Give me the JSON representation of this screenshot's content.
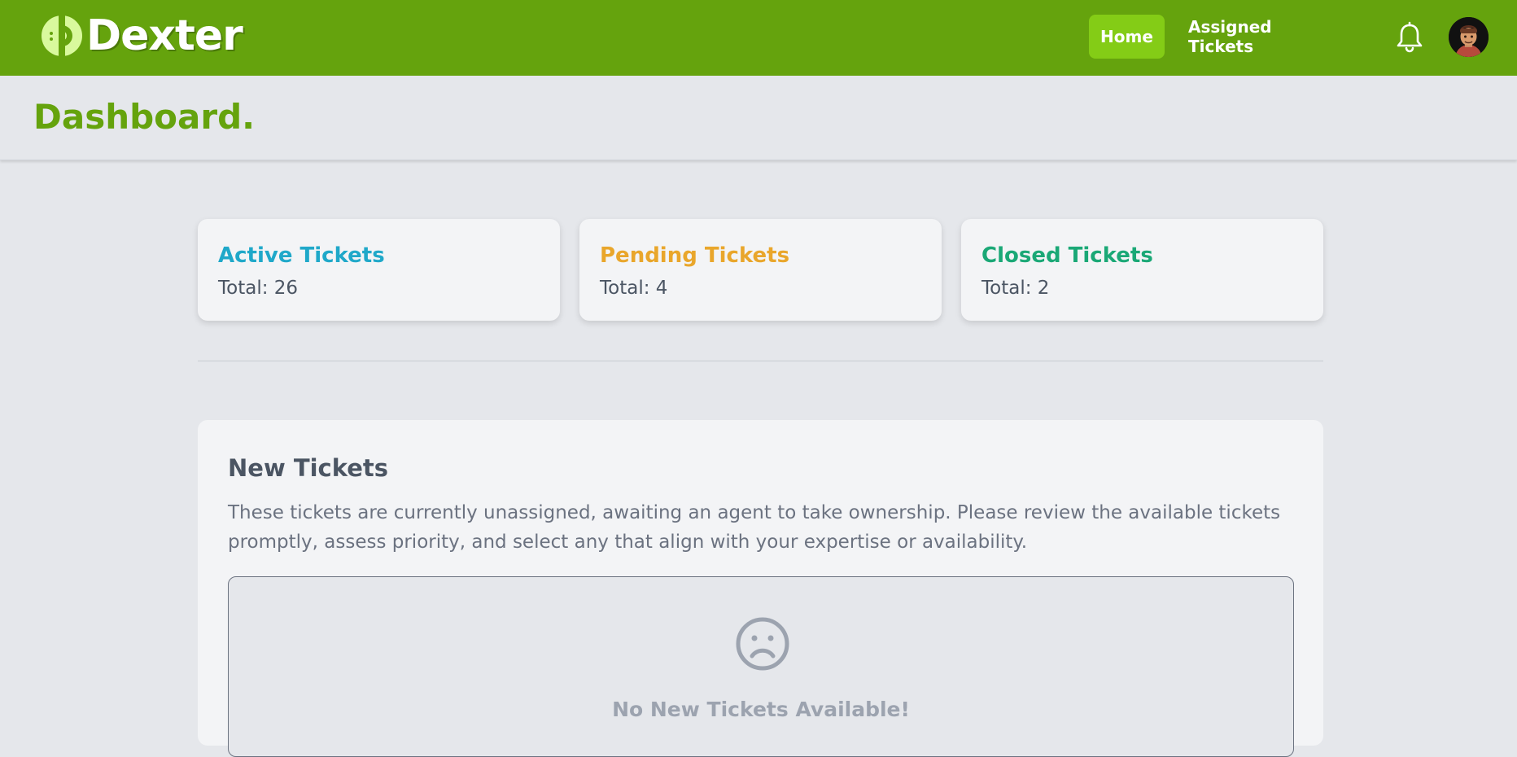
{
  "brand": {
    "name": "Dexter"
  },
  "nav": {
    "home": "Home",
    "assigned": "Assigned Tickets"
  },
  "page": {
    "title": "Dashboard."
  },
  "stats": [
    {
      "title": "Active Tickets",
      "total": "Total: 26",
      "color": "#1fa8c9"
    },
    {
      "title": "Pending Tickets",
      "total": "Total: 4",
      "color": "#e9a62b"
    },
    {
      "title": "Closed Tickets",
      "total": "Total: 2",
      "color": "#1aa876"
    }
  ],
  "new_tickets": {
    "title": "New Tickets",
    "description": "These tickets are currently unassigned, awaiting an agent to take ownership. Please review the available tickets promptly, assess priority, and select any that align with your expertise or availability.",
    "empty_message": "No New Tickets Available!"
  },
  "icons": [
    "logo-icon",
    "bell-icon",
    "avatar",
    "sad-face-icon"
  ],
  "colors": {
    "brand": "#65a30d",
    "accent": "#84cc16"
  }
}
